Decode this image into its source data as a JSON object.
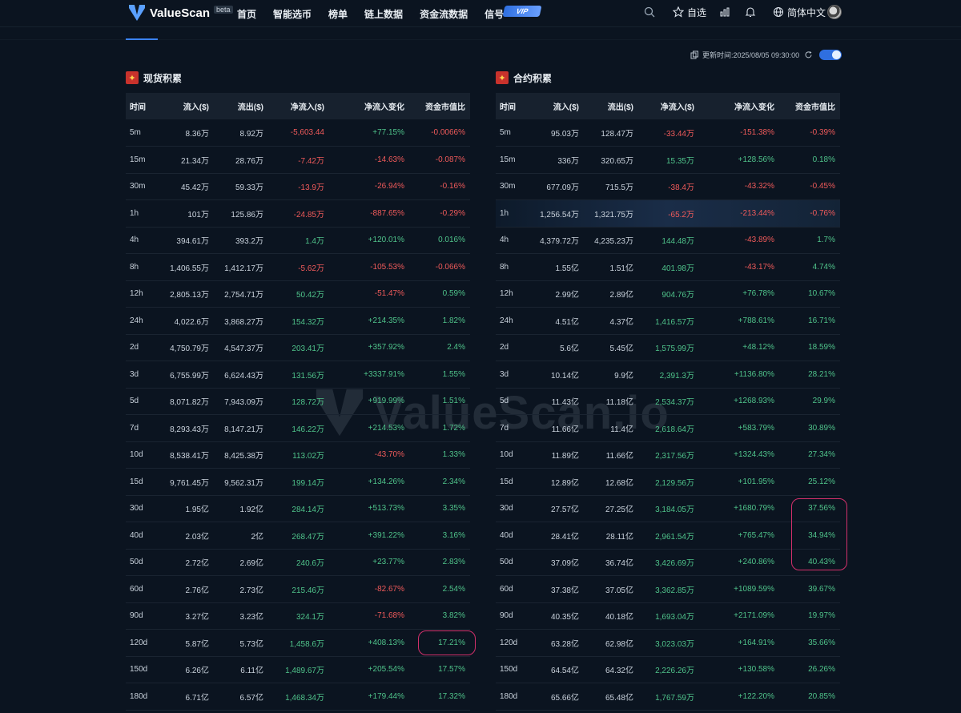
{
  "nav": {
    "logo_text": "ValueScan",
    "beta": "beta",
    "menu": [
      "首页",
      "智能选币",
      "榜单",
      "链上数据",
      "资金流数据",
      "信号"
    ],
    "vip": "VIP",
    "favorites": "自选",
    "language": "简体中文"
  },
  "update": {
    "text": "更新时间:2025/08/05 09:30:00"
  },
  "spot": {
    "title": "现货积累",
    "headers": [
      "时间",
      "流入($)",
      "流出($)",
      "净流入($)",
      "净流入变化",
      "资金市值比"
    ],
    "rows": [
      [
        "5m",
        "8.36万",
        "8.92万",
        "-5,603.44",
        "+77.15%",
        "-0.0066%"
      ],
      [
        "15m",
        "21.34万",
        "28.76万",
        "-7.42万",
        "-14.63%",
        "-0.087%"
      ],
      [
        "30m",
        "45.42万",
        "59.33万",
        "-13.9万",
        "-26.94%",
        "-0.16%"
      ],
      [
        "1h",
        "101万",
        "125.86万",
        "-24.85万",
        "-887.65%",
        "-0.29%"
      ],
      [
        "4h",
        "394.61万",
        "393.2万",
        "1.4万",
        "+120.01%",
        "0.016%"
      ],
      [
        "8h",
        "1,406.55万",
        "1,412.17万",
        "-5.62万",
        "-105.53%",
        "-0.066%"
      ],
      [
        "12h",
        "2,805.13万",
        "2,754.71万",
        "50.42万",
        "-51.47%",
        "0.59%"
      ],
      [
        "24h",
        "4,022.6万",
        "3,868.27万",
        "154.32万",
        "+214.35%",
        "1.82%"
      ],
      [
        "2d",
        "4,750.79万",
        "4,547.37万",
        "203.41万",
        "+357.92%",
        "2.4%"
      ],
      [
        "3d",
        "6,755.99万",
        "6,624.43万",
        "131.56万",
        "+3337.91%",
        "1.55%"
      ],
      [
        "5d",
        "8,071.82万",
        "7,943.09万",
        "128.72万",
        "+919.99%",
        "1.51%"
      ],
      [
        "7d",
        "8,293.43万",
        "8,147.21万",
        "146.22万",
        "+214.53%",
        "1.72%"
      ],
      [
        "10d",
        "8,538.41万",
        "8,425.38万",
        "113.02万",
        "-43.70%",
        "1.33%"
      ],
      [
        "15d",
        "9,761.45万",
        "9,562.31万",
        "199.14万",
        "+134.26%",
        "2.34%"
      ],
      [
        "30d",
        "1.95亿",
        "1.92亿",
        "284.14万",
        "+513.73%",
        "3.35%"
      ],
      [
        "40d",
        "2.03亿",
        "2亿",
        "268.47万",
        "+391.22%",
        "3.16%"
      ],
      [
        "50d",
        "2.72亿",
        "2.69亿",
        "240.6万",
        "+23.77%",
        "2.83%"
      ],
      [
        "60d",
        "2.76亿",
        "2.73亿",
        "215.46万",
        "-82.67%",
        "2.54%"
      ],
      [
        "90d",
        "3.27亿",
        "3.23亿",
        "324.1万",
        "-71.68%",
        "3.82%"
      ],
      [
        "120d",
        "5.87亿",
        "5.73亿",
        "1,458.6万",
        "+408.13%",
        "17.21%"
      ],
      [
        "150d",
        "6.26亿",
        "6.11亿",
        "1,489.67万",
        "+205.54%",
        "17.57%"
      ],
      [
        "180d",
        "6.71亿",
        "6.57亿",
        "1,468.34万",
        "+179.44%",
        "17.32%"
      ]
    ]
  },
  "futures": {
    "title": "合约积累",
    "headers": [
      "时间",
      "流入($)",
      "流出($)",
      "净流入($)",
      "净流入变化",
      "资金市值比"
    ],
    "rows": [
      [
        "5m",
        "95.03万",
        "128.47万",
        "-33.44万",
        "-151.38%",
        "-0.39%"
      ],
      [
        "15m",
        "336万",
        "320.65万",
        "15.35万",
        "+128.56%",
        "0.18%"
      ],
      [
        "30m",
        "677.09万",
        "715.5万",
        "-38.4万",
        "-43.32%",
        "-0.45%"
      ],
      [
        "1h",
        "1,256.54万",
        "1,321.75万",
        "-65.2万",
        "-213.44%",
        "-0.76%"
      ],
      [
        "4h",
        "4,379.72万",
        "4,235.23万",
        "144.48万",
        "-43.89%",
        "1.7%"
      ],
      [
        "8h",
        "1.55亿",
        "1.51亿",
        "401.98万",
        "-43.17%",
        "4.74%"
      ],
      [
        "12h",
        "2.99亿",
        "2.89亿",
        "904.76万",
        "+76.78%",
        "10.67%"
      ],
      [
        "24h",
        "4.51亿",
        "4.37亿",
        "1,416.57万",
        "+788.61%",
        "16.71%"
      ],
      [
        "2d",
        "5.6亿",
        "5.45亿",
        "1,575.99万",
        "+48.12%",
        "18.59%"
      ],
      [
        "3d",
        "10.14亿",
        "9.9亿",
        "2,391.3万",
        "+1136.80%",
        "28.21%"
      ],
      [
        "5d",
        "11.43亿",
        "11.18亿",
        "2,534.37万",
        "+1268.93%",
        "29.9%"
      ],
      [
        "7d",
        "11.66亿",
        "11.4亿",
        "2,618.64万",
        "+583.79%",
        "30.89%"
      ],
      [
        "10d",
        "11.89亿",
        "11.66亿",
        "2,317.56万",
        "+1324.43%",
        "27.34%"
      ],
      [
        "15d",
        "12.89亿",
        "12.68亿",
        "2,129.56万",
        "+101.95%",
        "25.12%"
      ],
      [
        "30d",
        "27.57亿",
        "27.25亿",
        "3,184.05万",
        "+1680.79%",
        "37.56%"
      ],
      [
        "40d",
        "28.41亿",
        "28.11亿",
        "2,961.54万",
        "+765.47%",
        "34.94%"
      ],
      [
        "50d",
        "37.09亿",
        "36.74亿",
        "3,426.69万",
        "+240.86%",
        "40.43%"
      ],
      [
        "60d",
        "37.38亿",
        "37.05亿",
        "3,362.85万",
        "+1089.59%",
        "39.67%"
      ],
      [
        "90d",
        "40.35亿",
        "40.18亿",
        "1,693.04万",
        "+2171.09%",
        "19.97%"
      ],
      [
        "120d",
        "63.28亿",
        "62.98亿",
        "3,023.03万",
        "+164.91%",
        "35.66%"
      ],
      [
        "150d",
        "64.54亿",
        "64.32亿",
        "2,226.26万",
        "+130.58%",
        "26.26%"
      ],
      [
        "180d",
        "65.66亿",
        "65.48亿",
        "1,767.59万",
        "+122.20%",
        "20.85%"
      ]
    ],
    "highlighted_row": "1h"
  },
  "watermark": "ValueScan.io",
  "colors": {
    "positive": "#4fc38a",
    "negative": "#ef5a5a",
    "accent": "#3b82f6",
    "annotation": "#d2306b"
  }
}
